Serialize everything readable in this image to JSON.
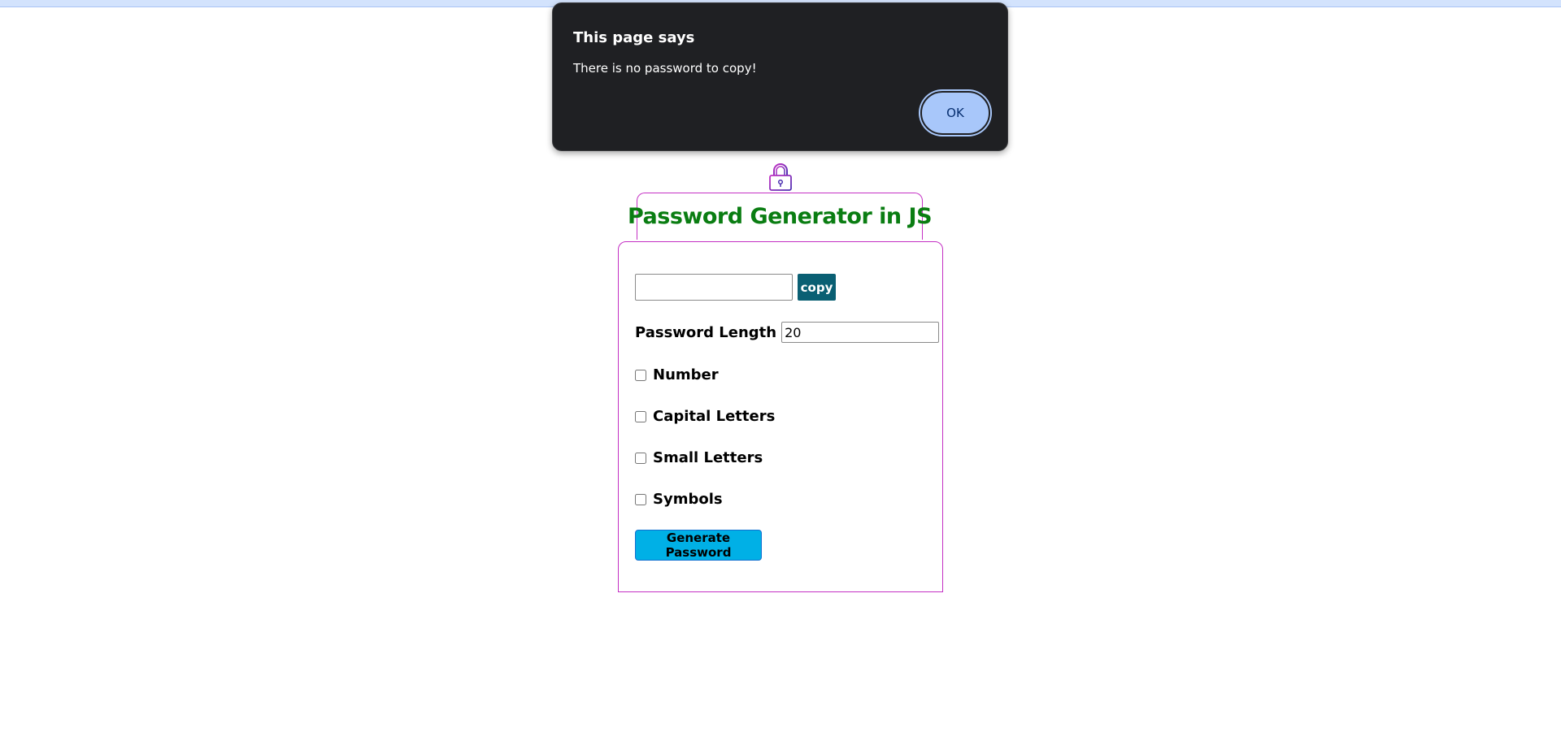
{
  "dialog": {
    "title": "This page says",
    "message": "There is no password to copy!",
    "ok_label": "OK"
  },
  "app": {
    "title": "Password Generator in JS",
    "password_value": "",
    "copy_label": "copy",
    "length_label": "Password Length",
    "length_value": "20",
    "options": [
      {
        "label": "Number",
        "checked": false
      },
      {
        "label": "Capital Letters",
        "checked": false
      },
      {
        "label": "Small Letters",
        "checked": false
      },
      {
        "label": "Symbols",
        "checked": false
      }
    ],
    "generate_label": "Generate Password"
  },
  "colors": {
    "title_green": "#0a7d12",
    "border_magenta": "#c430c4",
    "copy_button": "#0a5f73",
    "generate_button": "#00b0e6",
    "dialog_bg": "#1f2023",
    "ok_button": "#a8c7fa"
  },
  "icons": {
    "lock": "lock-icon"
  }
}
